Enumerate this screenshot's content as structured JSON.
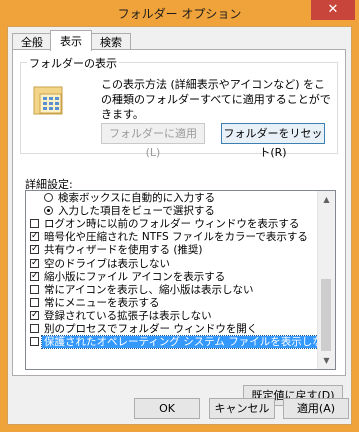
{
  "window": {
    "title": "フォルダー オプション",
    "close_label": "✕"
  },
  "tabs": [
    {
      "label": "全般"
    },
    {
      "label": "表示"
    },
    {
      "label": "検索"
    }
  ],
  "folder_views": {
    "group_label": "フォルダーの表示",
    "description": "この表示方法 (詳細表示やアイコンなど) をこの種類のフォルダーすべてに適用することができます。",
    "apply_button": "フォルダーに適用(L)",
    "reset_button": "フォルダーをリセット(R)"
  },
  "advanced": {
    "label": "詳細設定:",
    "items": [
      {
        "label": "検索ボックスに自動的に入力する",
        "type": "radio",
        "checked": false,
        "indent": 1
      },
      {
        "label": "入力した項目をビューで選択する",
        "type": "radio",
        "checked": true,
        "indent": 1
      },
      {
        "label": "ログオン時に以前のフォルダー ウィンドウを表示する",
        "type": "check",
        "checked": false,
        "indent": 0
      },
      {
        "label": "暗号化や圧縮された NTFS ファイルをカラーで表示する",
        "type": "check",
        "checked": true,
        "indent": 0
      },
      {
        "label": "共有ウィザードを使用する (推奨)",
        "type": "check",
        "checked": true,
        "indent": 0
      },
      {
        "label": "空のドライブは表示しない",
        "type": "check",
        "checked": true,
        "indent": 0
      },
      {
        "label": "縮小版にファイル アイコンを表示する",
        "type": "check",
        "checked": true,
        "indent": 0
      },
      {
        "label": "常にアイコンを表示し、縮小版は表示しない",
        "type": "check",
        "checked": false,
        "indent": 0
      },
      {
        "label": "常にメニューを表示する",
        "type": "check",
        "checked": false,
        "indent": 0
      },
      {
        "label": "登録されている拡張子は表示しない",
        "type": "check",
        "checked": true,
        "indent": 0
      },
      {
        "label": "別のプロセスでフォルダー ウィンドウを開く",
        "type": "check",
        "checked": false,
        "indent": 0
      },
      {
        "label": "保護されたオペレーティング システム ファイルを表示しない (推奨)",
        "type": "check",
        "checked": false,
        "indent": 0,
        "selected": true
      }
    ],
    "restore_button": "既定値に戻す(D)"
  },
  "buttons": {
    "ok": "OK",
    "cancel": "キャンセル",
    "apply": "適用(A)"
  },
  "colors": {
    "title_bar": "#f0a33a",
    "selection": "#3399ff",
    "close": "#c7453b"
  }
}
